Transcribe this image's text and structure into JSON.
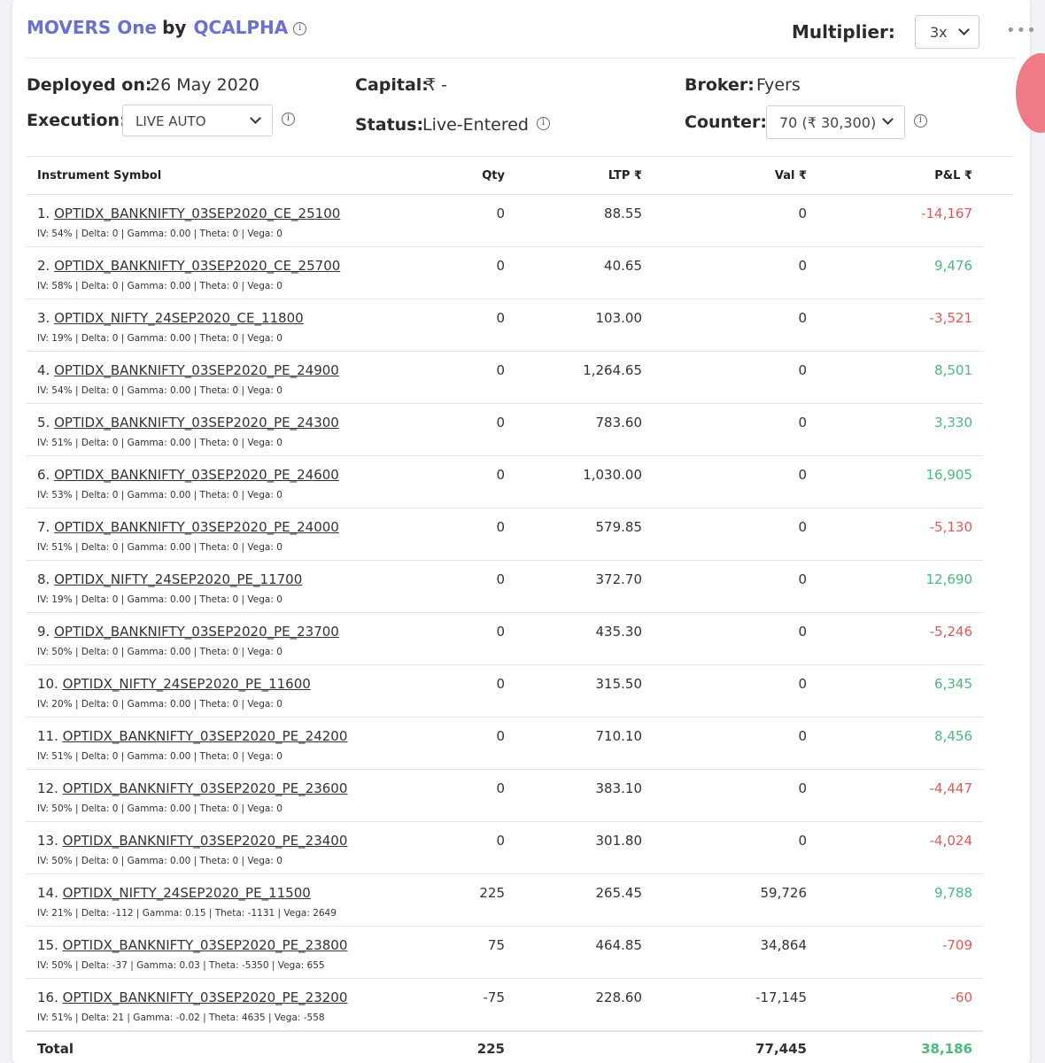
{
  "header": {
    "strategy_name": "MOVERS One",
    "by": "by",
    "author": "QCALPHA",
    "multiplier_label": "Multiplier:",
    "multiplier_value": "3x"
  },
  "details": {
    "deployed_label": "Deployed on:",
    "deployed_value": "26 May 2020",
    "capital_label": "Capital:",
    "capital_value": "₹  -",
    "broker_label": "Broker:",
    "broker_value": "Fyers",
    "execution_label": "Execution:",
    "execution_value": "LIVE AUTO",
    "status_label": "Status:",
    "status_value": "Live-Entered",
    "counter_label": "Counter:",
    "counter_value": "70 (₹ 30,300)"
  },
  "table": {
    "headers": {
      "symbol": "Instrument Symbol",
      "qty": "Qty",
      "ltp": "LTP ₹",
      "val": "Val ₹",
      "pnl": "P&L ₹"
    },
    "rows": [
      {
        "idx": "1.",
        "symbol": "OPTIDX_BANKNIFTY_03SEP2020_CE_25100",
        "greeks": "IV: 54% | Delta: 0 | Gamma: 0.00 | Theta: 0 | Vega: 0",
        "qty": "0",
        "ltp": "88.55",
        "val": "0",
        "pnl": "-14,167",
        "pnl_sign": "neg"
      },
      {
        "idx": "2.",
        "symbol": "OPTIDX_BANKNIFTY_03SEP2020_CE_25700",
        "greeks": "IV: 58% | Delta: 0 | Gamma: 0.00 | Theta: 0 | Vega: 0",
        "qty": "0",
        "ltp": "40.65",
        "val": "0",
        "pnl": "9,476",
        "pnl_sign": "pos"
      },
      {
        "idx": "3.",
        "symbol": "OPTIDX_NIFTY_24SEP2020_CE_11800",
        "greeks": "IV: 19% | Delta: 0 | Gamma: 0.00 | Theta: 0 | Vega: 0",
        "qty": "0",
        "ltp": "103.00",
        "val": "0",
        "pnl": "-3,521",
        "pnl_sign": "neg"
      },
      {
        "idx": "4.",
        "symbol": "OPTIDX_BANKNIFTY_03SEP2020_PE_24900",
        "greeks": "IV: 54% | Delta: 0 | Gamma: 0.00 | Theta: 0 | Vega: 0",
        "qty": "0",
        "ltp": "1,264.65",
        "val": "0",
        "pnl": "8,501",
        "pnl_sign": "pos"
      },
      {
        "idx": "5.",
        "symbol": "OPTIDX_BANKNIFTY_03SEP2020_PE_24300",
        "greeks": "IV: 51% | Delta: 0 | Gamma: 0.00 | Theta: 0 | Vega: 0",
        "qty": "0",
        "ltp": "783.60",
        "val": "0",
        "pnl": "3,330",
        "pnl_sign": "pos"
      },
      {
        "idx": "6.",
        "symbol": "OPTIDX_BANKNIFTY_03SEP2020_PE_24600",
        "greeks": "IV: 53% | Delta: 0 | Gamma: 0.00 | Theta: 0 | Vega: 0",
        "qty": "0",
        "ltp": "1,030.00",
        "val": "0",
        "pnl": "16,905",
        "pnl_sign": "pos"
      },
      {
        "idx": "7.",
        "symbol": "OPTIDX_BANKNIFTY_03SEP2020_PE_24000",
        "greeks": "IV: 51% | Delta: 0 | Gamma: 0.00 | Theta: 0 | Vega: 0",
        "qty": "0",
        "ltp": "579.85",
        "val": "0",
        "pnl": "-5,130",
        "pnl_sign": "neg"
      },
      {
        "idx": "8.",
        "symbol": "OPTIDX_NIFTY_24SEP2020_PE_11700",
        "greeks": "IV: 19% | Delta: 0 | Gamma: 0.00 | Theta: 0 | Vega: 0",
        "qty": "0",
        "ltp": "372.70",
        "val": "0",
        "pnl": "12,690",
        "pnl_sign": "pos"
      },
      {
        "idx": "9.",
        "symbol": "OPTIDX_BANKNIFTY_03SEP2020_PE_23700",
        "greeks": "IV: 50% | Delta: 0 | Gamma: 0.00 | Theta: 0 | Vega: 0",
        "qty": "0",
        "ltp": "435.30",
        "val": "0",
        "pnl": "-5,246",
        "pnl_sign": "neg"
      },
      {
        "idx": "10.",
        "symbol": "OPTIDX_NIFTY_24SEP2020_PE_11600",
        "greeks": "IV: 20% | Delta: 0 | Gamma: 0.00 | Theta: 0 | Vega: 0",
        "qty": "0",
        "ltp": "315.50",
        "val": "0",
        "pnl": "6,345",
        "pnl_sign": "pos"
      },
      {
        "idx": "11.",
        "symbol": "OPTIDX_BANKNIFTY_03SEP2020_PE_24200",
        "greeks": "IV: 51% | Delta: 0 | Gamma: 0.00 | Theta: 0 | Vega: 0",
        "qty": "0",
        "ltp": "710.10",
        "val": "0",
        "pnl": "8,456",
        "pnl_sign": "pos"
      },
      {
        "idx": "12.",
        "symbol": "OPTIDX_BANKNIFTY_03SEP2020_PE_23600",
        "greeks": "IV: 50% | Delta: 0 | Gamma: 0.00 | Theta: 0 | Vega: 0",
        "qty": "0",
        "ltp": "383.10",
        "val": "0",
        "pnl": "-4,447",
        "pnl_sign": "neg"
      },
      {
        "idx": "13.",
        "symbol": "OPTIDX_BANKNIFTY_03SEP2020_PE_23400",
        "greeks": "IV: 50% | Delta: 0 | Gamma: 0.00 | Theta: 0 | Vega: 0",
        "qty": "0",
        "ltp": "301.80",
        "val": "0",
        "pnl": "-4,024",
        "pnl_sign": "neg"
      },
      {
        "idx": "14.",
        "symbol": "OPTIDX_NIFTY_24SEP2020_PE_11500",
        "greeks": "IV: 21% | Delta: -112 | Gamma: 0.15 | Theta: -1131 | Vega: 2649",
        "qty": "225",
        "ltp": "265.45",
        "val": "59,726",
        "pnl": "9,788",
        "pnl_sign": "pos"
      },
      {
        "idx": "15.",
        "symbol": "OPTIDX_BANKNIFTY_03SEP2020_PE_23800",
        "greeks": "IV: 50% | Delta: -37 | Gamma: 0.03 | Theta: -5350 | Vega: 655",
        "qty": "75",
        "ltp": "464.85",
        "val": "34,864",
        "pnl": "-709",
        "pnl_sign": "neg"
      },
      {
        "idx": "16.",
        "symbol": "OPTIDX_BANKNIFTY_03SEP2020_PE_23200",
        "greeks": "IV: 51% | Delta: 21 | Gamma: -0.02 | Theta: 4635 | Vega: -558",
        "qty": "-75",
        "ltp": "228.60",
        "val": "-17,145",
        "pnl": "-60",
        "pnl_sign": "neg"
      }
    ],
    "total": {
      "label": "Total",
      "qty": "225",
      "val": "77,445",
      "pnl": "38,186"
    }
  },
  "colors": {
    "accent": "#6a6fd3",
    "loss": "#e05a5a",
    "profit": "#4cba7a"
  }
}
